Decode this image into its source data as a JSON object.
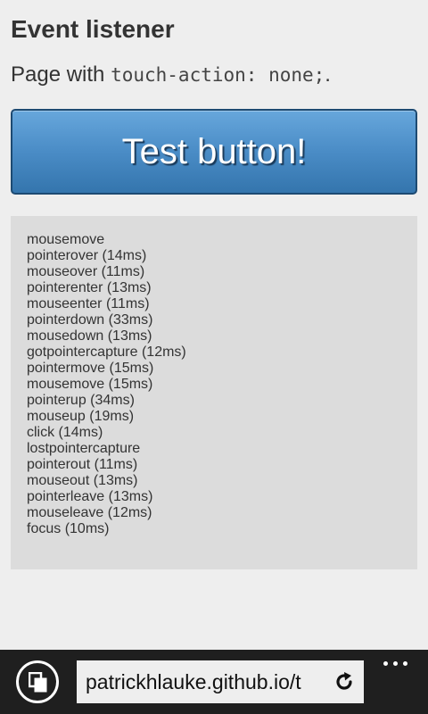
{
  "page": {
    "title": "Event listener",
    "intro_prefix": "Page with ",
    "intro_code": "touch-action: none;",
    "intro_suffix": "."
  },
  "test_button": {
    "label": "Test button!"
  },
  "event_log": [
    "mousemove",
    "pointerover (14ms)",
    "mouseover (11ms)",
    "pointerenter (13ms)",
    "mouseenter (11ms)",
    "pointerdown (33ms)",
    "mousedown (13ms)",
    "gotpointercapture (12ms)",
    "pointermove (15ms)",
    "mousemove (15ms)",
    "pointerup (34ms)",
    "mouseup (19ms)",
    "click (14ms)",
    "lostpointercapture",
    "pointerout (11ms)",
    "mouseout (13ms)",
    "pointerleave (13ms)",
    "mouseleave (12ms)",
    "focus (10ms)"
  ],
  "browser": {
    "address": "patrickhlauke.github.io/t",
    "icons": {
      "tabs": "tabs-icon",
      "refresh": "refresh-icon",
      "more": "more-icon"
    },
    "colors": {
      "bar": "#1f1f1f",
      "address_bg": "#eeeeee"
    }
  },
  "colors": {
    "page_bg": "#eeeeee",
    "button_top": "#67a7dc",
    "button_bottom": "#3475ad",
    "log_bg": "#dcdcdc"
  }
}
